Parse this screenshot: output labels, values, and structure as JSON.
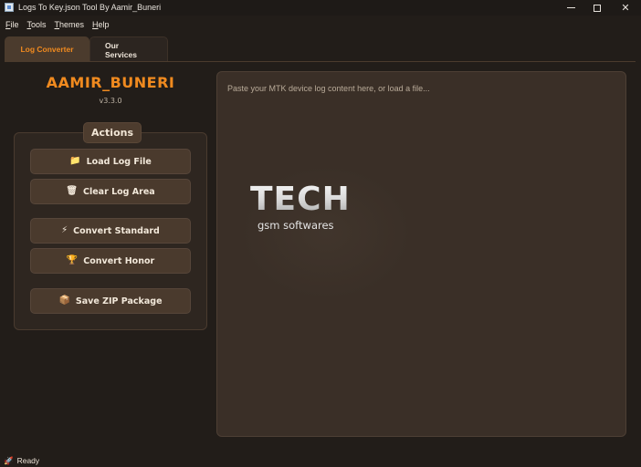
{
  "window": {
    "title": "Logs To Key.json Tool By Aamir_Buneri",
    "minimize_icon": "minimize-icon",
    "maximize_icon": "maximize-icon",
    "close_glyph": "✕"
  },
  "menu": [
    {
      "label": "File",
      "underline": "F",
      "rest": "ile"
    },
    {
      "label": "Tools",
      "underline": "T",
      "rest": "ools"
    },
    {
      "label": "Themes",
      "underline": "T",
      "rest": "hemes"
    },
    {
      "label": "Help",
      "underline": "H",
      "rest": "elp"
    }
  ],
  "tabs": [
    {
      "label": "Log Converter",
      "active": true
    },
    {
      "label": "Our Services",
      "active": false
    }
  ],
  "brand": {
    "name": "AAMIR_BUNERI",
    "version": "v3.3.0"
  },
  "actions": {
    "title": "Actions",
    "buttons": [
      {
        "label": "Load Log File",
        "icon": "folder-icon",
        "glyph": "📁"
      },
      {
        "label": "Clear Log Area",
        "icon": "trash-icon",
        "glyph": "🗑"
      },
      {
        "label": "Convert Standard",
        "icon": "lightning-icon",
        "glyph": "⚡"
      },
      {
        "label": "Convert Honor",
        "icon": "trophy-icon",
        "glyph": "🏆"
      },
      {
        "label": "Save ZIP Package",
        "icon": "package-icon",
        "glyph": "📦"
      }
    ]
  },
  "log_area": {
    "placeholder": "Paste your MTK device log content here, or load a file..."
  },
  "watermark": {
    "title": "TECH",
    "subtitle": "gsm softwares"
  },
  "status": {
    "glyph": "🚀",
    "icon": "rocket-icon",
    "text": "Ready"
  },
  "colors": {
    "accent": "#f08a1f",
    "background": "#221d19",
    "button": "#4a3a2d",
    "text_area": "#3a2f27"
  }
}
